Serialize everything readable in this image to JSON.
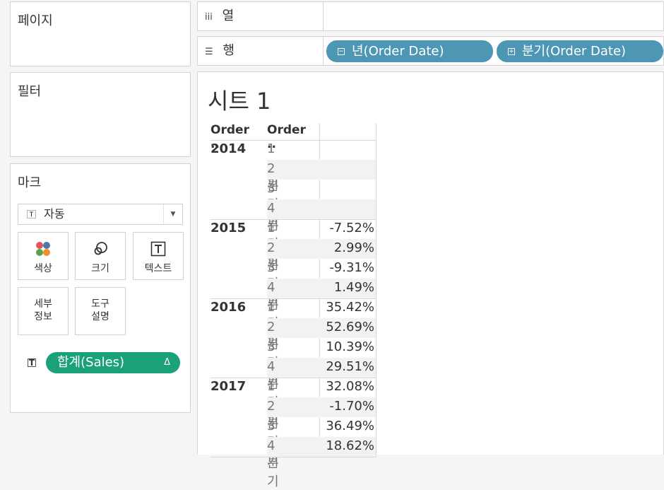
{
  "left_panel": {
    "pages_title": "페이지",
    "filters_title": "필터",
    "marks_title": "마크",
    "mark_type": "자동",
    "mark_cards": {
      "color": "색상",
      "size": "크기",
      "text": "텍스트",
      "detail_line1": "세부",
      "detail_line2": "정보",
      "tooltip_line1": "도구",
      "tooltip_line2": "설명"
    },
    "sales_pill": {
      "label": "합계(Sales)",
      "delta": "Δ"
    },
    "colors": {
      "sales_pill": "#1aa179",
      "dots": [
        "#e15759",
        "#4e79a7",
        "#59a14f",
        "#f28e2b"
      ]
    }
  },
  "shelves": {
    "columns_label": "열",
    "rows_label": "행",
    "row_pills": [
      {
        "label": "년(Order Date)",
        "icon": "−"
      },
      {
        "label": "분기(Order Date)",
        "icon": "+"
      }
    ],
    "pill_color": "#4e97b4"
  },
  "sheet": {
    "title": "시트 1",
    "headers": [
      "Order ..",
      "Order .."
    ],
    "years": [
      {
        "year": "2014",
        "rows": [
          {
            "q": "1분기",
            "v": ""
          },
          {
            "q": "2분기",
            "v": ""
          },
          {
            "q": "3분기",
            "v": ""
          },
          {
            "q": "4분기",
            "v": ""
          }
        ]
      },
      {
        "year": "2015",
        "rows": [
          {
            "q": "1분기",
            "v": "-7.52%"
          },
          {
            "q": "2분기",
            "v": "2.99%"
          },
          {
            "q": "3분기",
            "v": "-9.31%"
          },
          {
            "q": "4분기",
            "v": "1.49%"
          }
        ]
      },
      {
        "year": "2016",
        "rows": [
          {
            "q": "1분기",
            "v": "35.42%"
          },
          {
            "q": "2분기",
            "v": "52.69%"
          },
          {
            "q": "3분기",
            "v": "10.39%"
          },
          {
            "q": "4분기",
            "v": "29.51%"
          }
        ]
      },
      {
        "year": "2017",
        "rows": [
          {
            "q": "1분기",
            "v": "32.08%"
          },
          {
            "q": "2분기",
            "v": "-1.70%"
          },
          {
            "q": "3분기",
            "v": "36.49%"
          },
          {
            "q": "4분기",
            "v": "18.62%"
          }
        ]
      }
    ]
  }
}
